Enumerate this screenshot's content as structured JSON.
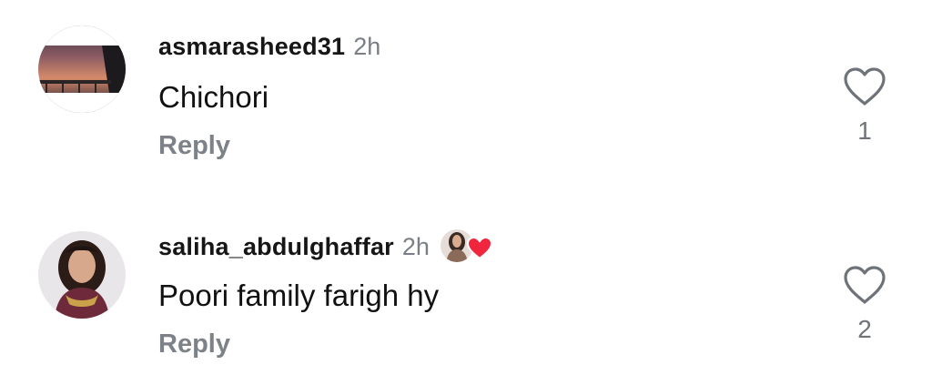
{
  "comments": [
    {
      "username": "asmarasheed31",
      "time": "2h",
      "text": "Chichori",
      "reply_label": "Reply",
      "like_count": "1",
      "avatar": "sunset-photo-avatar"
    },
    {
      "username": "saliha_abdulghaffar",
      "time": "2h",
      "text": "Poori family farigh hy",
      "reply_label": "Reply",
      "like_count": "2",
      "avatar": "woman-portrait-avatar",
      "liked_by_creator_icon": "creator-heart-icon"
    }
  ],
  "colors": {
    "username": "#161616",
    "meta": "#7a7f87",
    "heart_red": "#f0263f",
    "like_outline": "#6e737a"
  }
}
